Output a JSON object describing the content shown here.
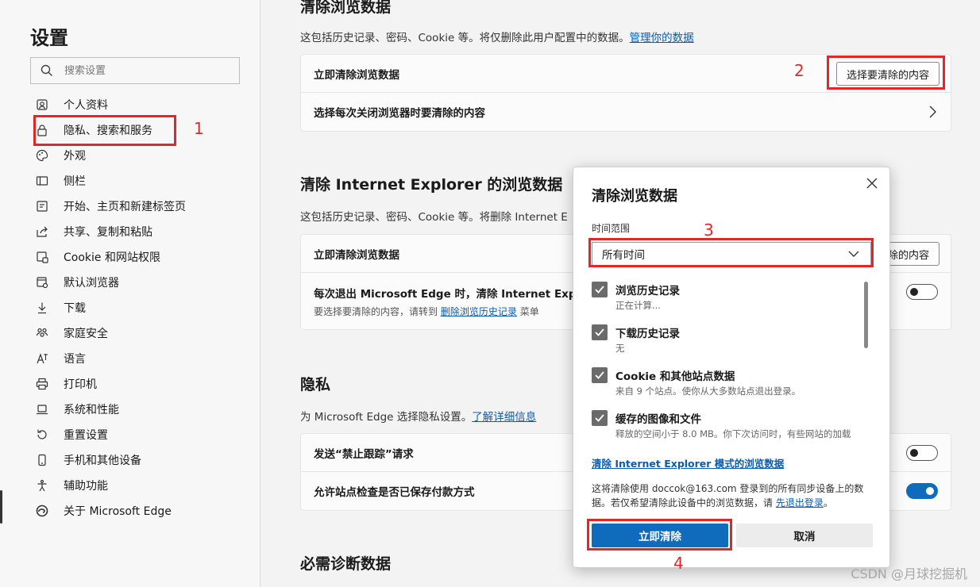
{
  "sidebar": {
    "title": "设置",
    "search_placeholder": "搜索设置",
    "items": [
      {
        "label": "个人资料",
        "icon": "profile-icon"
      },
      {
        "label": "隐私、搜索和服务",
        "icon": "lock-icon"
      },
      {
        "label": "外观",
        "icon": "palette-icon"
      },
      {
        "label": "侧栏",
        "icon": "sidebar-icon"
      },
      {
        "label": "开始、主页和新建标签页",
        "icon": "home-icon"
      },
      {
        "label": "共享、复制和粘贴",
        "icon": "share-icon"
      },
      {
        "label": "Cookie 和网站权限",
        "icon": "cookie-icon"
      },
      {
        "label": "默认浏览器",
        "icon": "browser-icon"
      },
      {
        "label": "下载",
        "icon": "download-icon"
      },
      {
        "label": "家庭安全",
        "icon": "family-icon"
      },
      {
        "label": "语言",
        "icon": "language-icon"
      },
      {
        "label": "打印机",
        "icon": "printer-icon"
      },
      {
        "label": "系统和性能",
        "icon": "laptop-icon"
      },
      {
        "label": "重置设置",
        "icon": "reset-icon"
      },
      {
        "label": "手机和其他设备",
        "icon": "phone-icon"
      },
      {
        "label": "辅助功能",
        "icon": "accessibility-icon"
      },
      {
        "label": "关于 Microsoft Edge",
        "icon": "edge-icon"
      }
    ]
  },
  "main": {
    "clear_section": {
      "title": "清除浏览数据",
      "desc": "这包括历史记录、密码、Cookie 等。将仅删除此用户配置中的数据。",
      "desc_link": "管理你的数据",
      "row1_label": "立即清除浏览数据",
      "row1_button": "选择要清除的内容",
      "row2_label": "选择每次关闭浏览器时要清除的内容"
    },
    "ie_section": {
      "title": "清除 Internet Explorer 的浏览数据",
      "desc": "这包括历史记录、密码、Cookie 等。将删除 Internet E",
      "row1_label": "立即清除浏览数据",
      "row1_button": "除的内容",
      "row2_label": "每次退出 Microsoft Edge 时，清除 Internet Explo",
      "row2_sub_prefix": "要选择要清除的内容，请转到",
      "row2_sub_link": "删除浏览历史记录",
      "row2_sub_suffix": "菜单"
    },
    "privacy_section": {
      "title": "隐私",
      "desc": "为 Microsoft Edge 选择隐私设置。",
      "desc_link": "了解详细信息",
      "row1_label": "发送“禁止跟踪”请求",
      "row2_label": "允许站点检查是否已保存付款方式"
    },
    "diag_section": {
      "title": "必需诊断数据"
    }
  },
  "dialog": {
    "title": "清除浏览数据",
    "range_label": "时间范围",
    "range_value": "所有时间",
    "items": [
      {
        "label": "浏览历史记录",
        "desc": "正在计算...",
        "checked": true
      },
      {
        "label": "下载历史记录",
        "desc": "无",
        "checked": true
      },
      {
        "label": "Cookie 和其他站点数据",
        "desc": "来自 9 个站点。使你从大多数站点退出登录。",
        "checked": true
      },
      {
        "label": "缓存的图像和文件",
        "desc": "释放的空间小于 8.0 MB。你下次访问时，有些网站的加载",
        "checked": true
      }
    ],
    "ie_link": "清除 Internet Explorer 模式的浏览数据",
    "sync_note_prefix": "这将清除使用 doccok@163.com 登录到的所有同步设备上的数据。若仅希望清除此设备中的浏览数据，请",
    "sync_note_link": "先退出登录",
    "sync_note_suffix": "。",
    "clear_button": "立即清除",
    "cancel_button": "取消"
  },
  "annotations": [
    "1",
    "2",
    "3",
    "4"
  ],
  "watermark": "CSDN @月球挖掘机",
  "colors": {
    "accent": "#0f6cbd",
    "annotation": "#e52626"
  }
}
